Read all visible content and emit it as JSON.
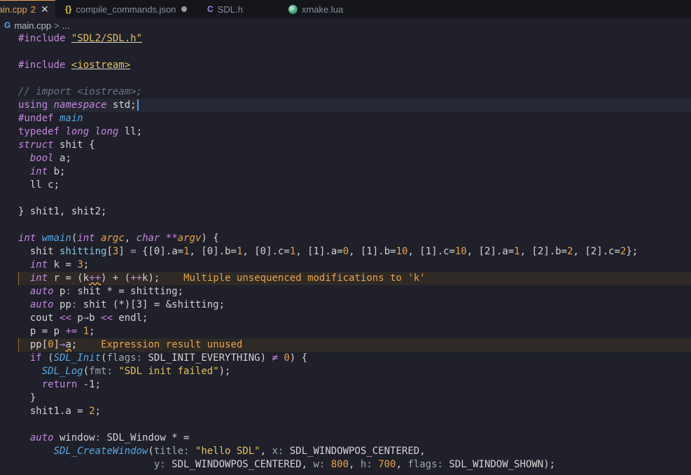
{
  "tabs": [
    {
      "label": "main.cpp",
      "badge": "2",
      "close": "✕"
    },
    {
      "label": "compile_commands.json",
      "icon": "{}",
      "dirty": true
    },
    {
      "label": "SDL.h",
      "icon": "C"
    },
    {
      "label": "xmake.lua",
      "icon": "lua-icon"
    }
  ],
  "breadcrumb": {
    "file": "main.cpp",
    "sep": ">",
    "more": "..."
  },
  "code": {
    "inc1_kw": "#include",
    "inc1_path": "\"SDL2/SDL.h\"",
    "inc2_kw": "#include",
    "inc2_path": "<iostream>",
    "comment": "// import <iostream>;",
    "using_kw": "using",
    "namespace_kw": "namespace",
    "std": "std;",
    "undef_kw": "#undef",
    "undef_name": "main",
    "typedef_kw": "typedef",
    "long1": "long",
    "long2": "long",
    "ll_name": "ll;",
    "struct_kw": "struct",
    "struct_name": "shit {",
    "bool_kw": "bool",
    "a_decl": "a;",
    "int_kw": "int",
    "b_decl": "b;",
    "c_decl": "ll c;",
    "struct_end": "} shit1, shit2;",
    "main_ret": "int",
    "main_name": "wmain",
    "p_int": "int",
    "p_argc": "argc",
    "p_char": "char",
    "p_argv": "argv",
    "shitting_line_a": "shit ",
    "shitting_name": "shitting",
    "arr_size": "3",
    "init_list_a": "{[0].a=",
    "v1": "1",
    "init_b": ", [0].b=",
    "v2": "1",
    "init_c": ", [0].c=",
    "v3": "1",
    "init_d": ", [1].a=",
    "v4": "0",
    "init_e": ", [1].b=",
    "v5": "10",
    "init_f": ", [1].c=",
    "v6": "10",
    "init_g": ", [2].a=",
    "v7": "1",
    "init_h": ", [2].b=",
    "v8": "2",
    "init_i": ", [2].c=",
    "v9": "2",
    "init_end": "};",
    "k_decl": "k = ",
    "k_val": "3",
    "semi": ";",
    "r_decl": "r = (k",
    "pp_inc": "++",
    "r_mid": ") + (",
    "pp_inc2": "++",
    "r_end": "k);",
    "diag_k": "Multiple unsequenced modifications to 'k'",
    "auto_kw": "auto",
    "p_decl": "p",
    "hint_colon": ":",
    "p_type": " shit * = shitting;",
    "pp_decl": "pp",
    "pp_type": " shit (*)[3] = &shitting;",
    "cout_a": "cout ",
    "shl": "<<",
    "cout_b": " p",
    "arrow": "→",
    "cout_c": "b ",
    "cout_d": " endl;",
    "p_assign_a": "p = p ",
    "pluseq": "+=",
    "p_assign_one": "1",
    "pp0_a": "pp[",
    "pp0_z": "0",
    "pp0_b": "]",
    "pp0_c": "a",
    "diag_expr": "Expression result unused",
    "if_kw": "if",
    "if_a": " (",
    "sdl_init": "SDL_Init",
    "hint_flags": "flags:",
    "init_everything": " SDL_INIT_EVERYTHING",
    "neq": "≠",
    "zero": "0",
    "if_end": ") {",
    "sdl_log": "SDL_Log",
    "hint_fmt": "fmt:",
    "log_str": "\"SDL init failed\"",
    "log_end": ");",
    "return_kw": "return",
    "ret_val": " -1;",
    "close_brace": "}",
    "shit1a": "shit1.a = ",
    "two": "2",
    "window_decl": " window",
    "window_type": " SDL_Window * =",
    "create_window": "SDL_CreateWindow",
    "hint_title": "title:",
    "title_str": "\"hello SDL\"",
    "hint_x": "x:",
    "pos_centered": " SDL_WINDOWPOS_CENTERED,",
    "hint_y": "y:",
    "pos_centered2": " SDL_WINDOWPOS_CENTERED, ",
    "hint_w": "w:",
    "w_val": "800",
    "hint_h": "h:",
    "h_val": "700",
    "hint_flags2": "flags:",
    "shown": " SDL_WINDOW_SHOWN);"
  }
}
